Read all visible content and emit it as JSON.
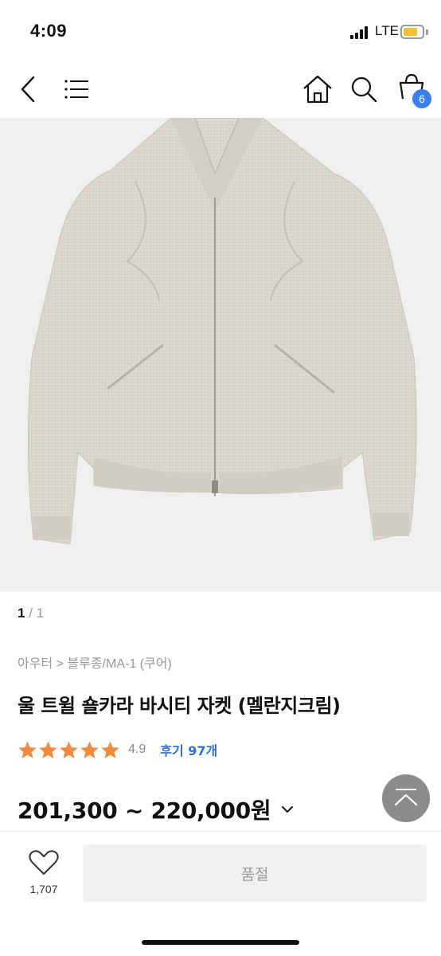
{
  "status_bar": {
    "time": "4:09",
    "network": "LTE",
    "battery_color": "#f1c232"
  },
  "nav": {
    "back_icon": "chevron-left-icon",
    "menu_icon": "hamburger-menu-icon",
    "home_icon": "home-icon",
    "search_icon": "search-icon",
    "bag_icon": "shopping-bag-icon",
    "cart_count": "6"
  },
  "gallery": {
    "current": "1",
    "total": " / 1",
    "image_icon": "jacket-photo"
  },
  "product": {
    "breadcrumb": "아우터 > 블루종/MA-1 (쿠어)",
    "title": "울 트윌 숄카라 바시티 자켓 (멜란지크림)",
    "rating_stars": 5,
    "rating_value": "4.9",
    "review_link": "후기 97개",
    "price": "201,300 ~ 220,000원",
    "star_color": "#f08a3c",
    "accent_color": "#2f6fd6"
  },
  "bottom_bar": {
    "like_icon": "heart-outline-icon",
    "like_count": "1,707",
    "soldout_label": "품절"
  }
}
